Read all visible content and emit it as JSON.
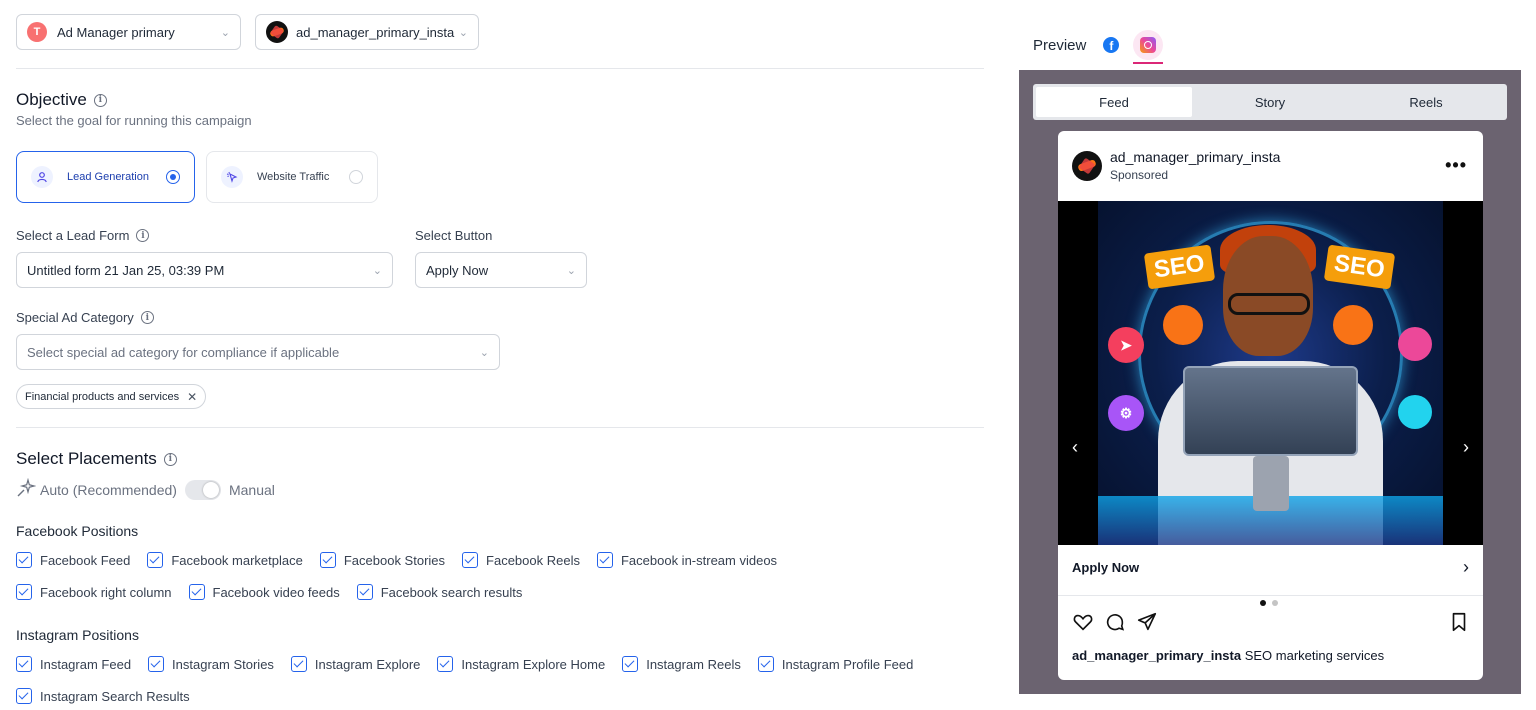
{
  "accounts": {
    "ad_account": {
      "initial": "T",
      "label": "Ad Manager primary"
    },
    "page": {
      "label": "ad_manager_primary_insta"
    }
  },
  "objective": {
    "title": "Objective",
    "subtitle": "Select the goal for running this campaign",
    "options": [
      {
        "label": "Lead Generation",
        "selected": true
      },
      {
        "label": "Website Traffic",
        "selected": false
      }
    ]
  },
  "lead_form": {
    "label": "Select a Lead Form",
    "value": "Untitled form 21 Jan 25, 03:39 PM"
  },
  "select_button": {
    "label": "Select Button",
    "value": "Apply Now"
  },
  "special_category": {
    "label": "Special Ad Category",
    "placeholder": "Select special ad category for compliance if applicable",
    "chips": [
      "Financial products and services"
    ]
  },
  "placements": {
    "title": "Select Placements",
    "auto_label": "Auto (Recommended)",
    "manual_label": "Manual",
    "facebook_title": "Facebook Positions",
    "facebook_row1": [
      "Facebook Feed",
      "Facebook marketplace",
      "Facebook Stories",
      "Facebook Reels",
      "Facebook in-stream videos"
    ],
    "facebook_row2": [
      "Facebook right column",
      "Facebook video feeds",
      "Facebook search results"
    ],
    "instagram_title": "Instagram Positions",
    "instagram_row1": [
      "Instagram Feed",
      "Instagram Stories",
      "Instagram Explore",
      "Instagram Explore Home",
      "Instagram Reels",
      "Instagram Profile Feed"
    ],
    "instagram_row2": [
      "Instagram Search Results"
    ]
  },
  "preview": {
    "title": "Preview",
    "tabs": [
      "Feed",
      "Story",
      "Reels"
    ],
    "active_tab": "Feed",
    "post": {
      "username": "ad_manager_primary_insta",
      "sponsored": "Sponsored",
      "seo_left": "SEO",
      "seo_right": "SEO",
      "cta": "Apply Now",
      "caption_user": "ad_manager_primary_insta",
      "caption_text": "SEO marketing services"
    }
  },
  "colors": {
    "accent": "#2563eb",
    "preview_bg": "#6b6370",
    "instagram": "#db2777",
    "facebook": "#1877f2"
  },
  "icons": [
    "info-icon",
    "user-icon",
    "cursor-click-icon",
    "sparkle-icon",
    "chevron-down-icon",
    "close-icon",
    "facebook-icon",
    "instagram-icon",
    "more-icon",
    "heart-icon",
    "comment-icon",
    "send-icon",
    "bookmark-icon",
    "chevron-left-icon",
    "chevron-right-icon"
  ]
}
